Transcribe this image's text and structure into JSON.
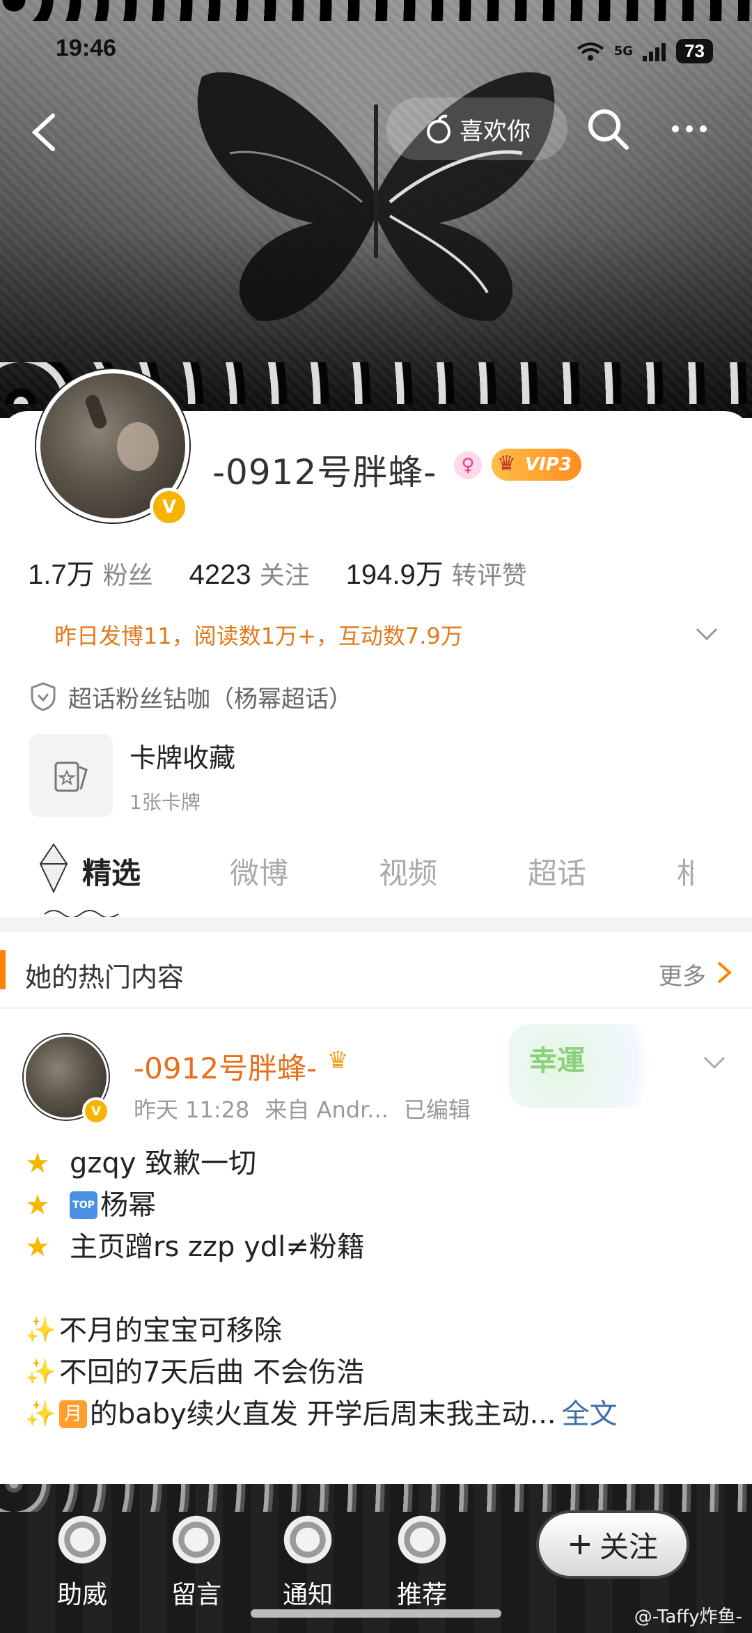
{
  "status_bar": {
    "time": "19:46",
    "network": "5G",
    "battery": "73"
  },
  "nav": {
    "back_icon": "chevron-left-icon",
    "like_label": "喜欢你",
    "like_icon": "fruit-icon",
    "search_icon": "search-icon",
    "more_icon": "more-dots-icon"
  },
  "profile": {
    "name": "-0912号胖蜂-",
    "gender_icon": "female-icon",
    "vip_label": "VIP3",
    "verified_icon": "verified-v-icon",
    "verified_mark": "V",
    "stats": [
      {
        "value": "1.7万",
        "label": "粉丝"
      },
      {
        "value": "4223",
        "label": "关注"
      },
      {
        "value": "194.9万",
        "label": "转评赞"
      }
    ],
    "activity": "昨日发博11，阅读数1万+，互动数7.9万",
    "supertopic": "超话粉丝钻咖（杨幂超话）",
    "card": {
      "title": "卡牌收藏",
      "subtitle": "1张卡牌"
    }
  },
  "tabs": [
    {
      "label": "精选",
      "active": true
    },
    {
      "label": "微博",
      "active": false
    },
    {
      "label": "视频",
      "active": false
    },
    {
      "label": "超话",
      "active": false
    },
    {
      "label": "相",
      "active": false
    }
  ],
  "hot_section": {
    "title": "她的热门内容",
    "more_label": "更多"
  },
  "post": {
    "author": "-0912号胖蜂-",
    "time": "昨天 11:28",
    "source": "来自 Andr...",
    "edited": "已编辑",
    "sticker_text": "幸運",
    "lines": [
      {
        "prefix": "star",
        "text": "gzqy 致歉一切"
      },
      {
        "prefix": "star",
        "badge": "TOP",
        "text": "杨幂"
      },
      {
        "prefix": "star",
        "text": "主页蹭rs zzp ydl≠粉籍"
      },
      {
        "prefix": "blank",
        "text": ""
      },
      {
        "prefix": "sparkle",
        "text": "不月的宝宝可移除"
      },
      {
        "prefix": "sparkle",
        "text": "不回的7天后曲 不会伤浩"
      },
      {
        "prefix": "sparkle",
        "badge": "月",
        "text": "的baby续火直发 开学后周末我主动..."
      }
    ],
    "fulltext_label": "全文"
  },
  "bottom_bar": {
    "items": [
      {
        "label": "助威",
        "icon": "rose-emblem-icon"
      },
      {
        "label": "留言",
        "icon": "chess-piece-icon"
      },
      {
        "label": "通知",
        "icon": "heart-emblem-icon"
      },
      {
        "label": "推荐",
        "icon": "flower-emblem-icon"
      }
    ],
    "follow_label": "关注",
    "follow_icon": "plus-icon"
  },
  "watermark": "@-Taffy炸鱼-"
}
